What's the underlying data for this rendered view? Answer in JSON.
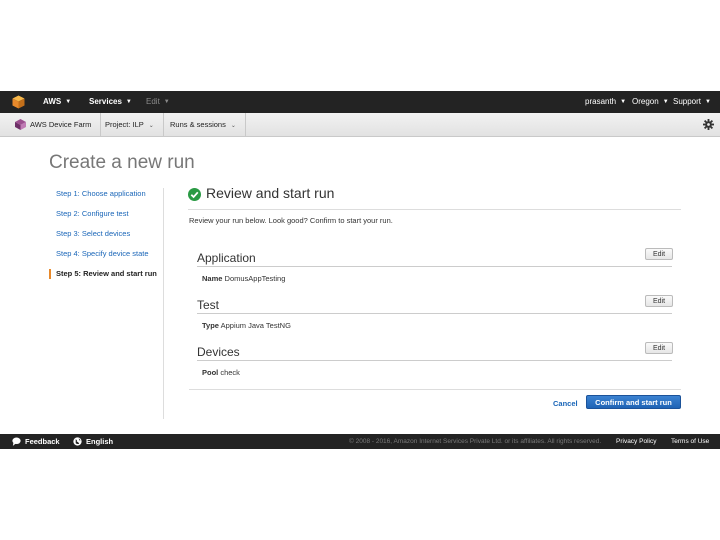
{
  "topnav": {
    "aws": "AWS",
    "services": "Services",
    "edit": "Edit",
    "user": "prasanth",
    "region": "Oregon",
    "support": "Support"
  },
  "subnav": {
    "device_farm": "AWS Device Farm",
    "project": "Project: ILP",
    "runs": "Runs & sessions"
  },
  "page_title": "Create a new run",
  "steps": [
    "Step 1: Choose application",
    "Step 2: Configure test",
    "Step 3: Select devices",
    "Step 4: Specify device state",
    "Step 5: Review and start run"
  ],
  "review": {
    "title": "Review and start run",
    "description": "Review your run below. Look good? Confirm to start your run."
  },
  "sections": [
    {
      "title": "Application",
      "key": "Name",
      "value": "DomusAppTesting",
      "edit": "Edit"
    },
    {
      "title": "Test",
      "key": "Type",
      "value": "Appium Java TestNG",
      "edit": "Edit"
    },
    {
      "title": "Devices",
      "key": "Pool",
      "value": "check",
      "edit": "Edit"
    }
  ],
  "actions": {
    "cancel": "Cancel",
    "confirm": "Confirm and start run"
  },
  "footer": {
    "feedback": "Feedback",
    "language": "English",
    "copyright": "© 2008 - 2016, Amazon Internet Services Private Ltd. or its affiliates. All rights reserved.",
    "privacy": "Privacy Policy",
    "terms": "Terms of Use"
  },
  "colors": {
    "accent": "#e8892b",
    "link": "#1a66b8",
    "primary_button": "#1f63b5",
    "success": "#2a9a44"
  }
}
